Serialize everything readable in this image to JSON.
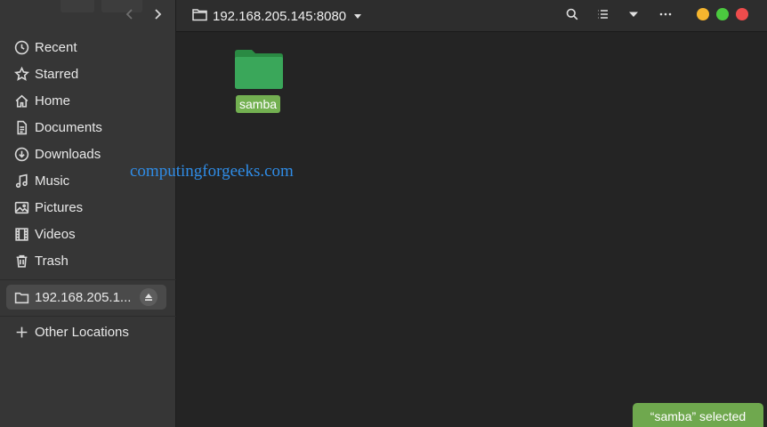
{
  "sidebar": {
    "items": [
      {
        "label": "Recent",
        "icon": "clock-icon"
      },
      {
        "label": "Starred",
        "icon": "star-icon"
      },
      {
        "label": "Home",
        "icon": "home-icon"
      },
      {
        "label": "Documents",
        "icon": "document-icon"
      },
      {
        "label": "Downloads",
        "icon": "download-icon"
      },
      {
        "label": "Music",
        "icon": "music-icon"
      },
      {
        "label": "Pictures",
        "icon": "picture-icon"
      },
      {
        "label": "Videos",
        "icon": "video-icon"
      },
      {
        "label": "Trash",
        "icon": "trash-icon"
      }
    ],
    "mount": {
      "label": "192.168.205.1...",
      "icon": "folder-icon",
      "action_icon": "eject-icon"
    },
    "other_locations": {
      "label": "Other Locations",
      "icon": "plus-icon"
    }
  },
  "header": {
    "path": "192.168.205.145:8080",
    "back_icon": "chevron-left-icon",
    "forward_icon": "chevron-right-icon",
    "search_icon": "search-icon",
    "view_icon": "list-view-icon",
    "view_menu_icon": "chevron-down-icon",
    "menu_icon": "more-horizontal-icon",
    "window_controls": {
      "minimize": "#f5b52e",
      "maximize": "#4bc93f",
      "close": "#ee4c4c"
    }
  },
  "content": {
    "files": [
      {
        "name": "samba",
        "type": "folder",
        "selected": true,
        "color": "#2e9a4c"
      }
    ]
  },
  "watermark": "computingforgeeks.com",
  "status_bar": {
    "text": "“samba” selected",
    "color": "#6fa84e"
  }
}
